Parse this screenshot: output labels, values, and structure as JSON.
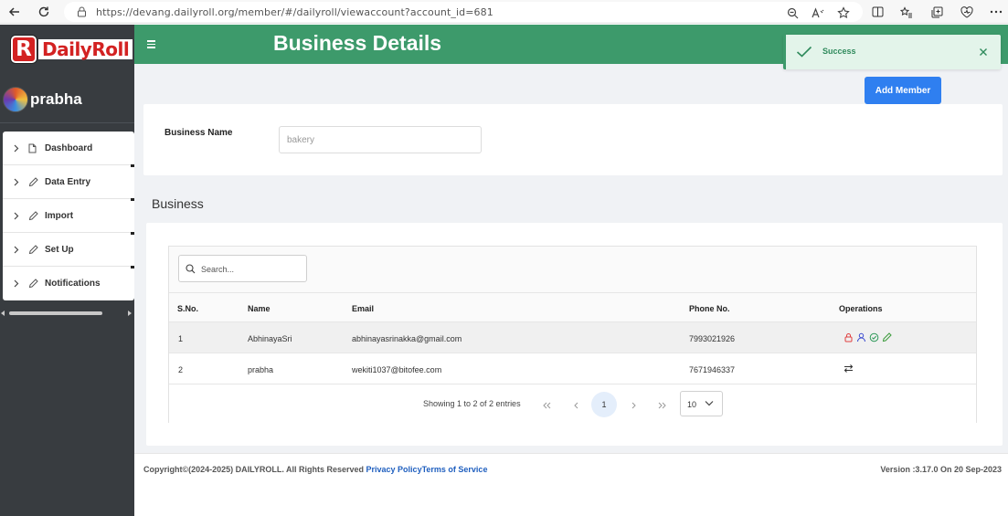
{
  "browser": {
    "url": "https://devang.dailyroll.org/member/#/dailyroll/viewaccount?account_id=681"
  },
  "sidebar": {
    "logo_letter": "R",
    "logo_text": "DailyRoll",
    "user_name": "prabha",
    "items": [
      {
        "label": "Dashboard",
        "icon": "file-icon"
      },
      {
        "label": "Data Entry",
        "icon": "pencil-icon"
      },
      {
        "label": "Import",
        "icon": "pencil-icon"
      },
      {
        "label": "Set Up",
        "icon": "pencil-icon"
      },
      {
        "label": "Notifications",
        "icon": "pencil-icon"
      }
    ]
  },
  "header": {
    "title": "Business Details"
  },
  "toast": {
    "message": "Success"
  },
  "actions": {
    "add_member": "Add Member"
  },
  "form": {
    "business_name_label": "Business Name",
    "business_name_value": "bakery"
  },
  "section": {
    "title": "Business"
  },
  "table": {
    "search_placeholder": "Search...",
    "columns": [
      "S.No.",
      "Name",
      "Email",
      "Phone No.",
      "Operations"
    ],
    "rows": [
      {
        "sno": "1",
        "name": "AbhinayaSri",
        "email": "abhinayasrinakka@gmail.com",
        "phone": "7993021926"
      },
      {
        "sno": "2",
        "name": "prabha",
        "email": "wekiti1037@bitofee.com",
        "phone": "7671946337"
      }
    ]
  },
  "pagination": {
    "info": "Showing 1 to 2 of 2 entries",
    "current_page": "1",
    "page_size": "10"
  },
  "footer": {
    "copyright": "Copyright©(2024-2025) DAILYROLL. All Rights Reserved ",
    "privacy": "Privacy Policy",
    "terms": "Terms of Service",
    "version": "Version :3.17.0 On 20 Sep-2023"
  },
  "colors": {
    "header_green": "#3d9a6b",
    "sidebar_dark": "#383c40",
    "primary_blue": "#2f7ff0",
    "link_blue": "#1f5fbf"
  }
}
